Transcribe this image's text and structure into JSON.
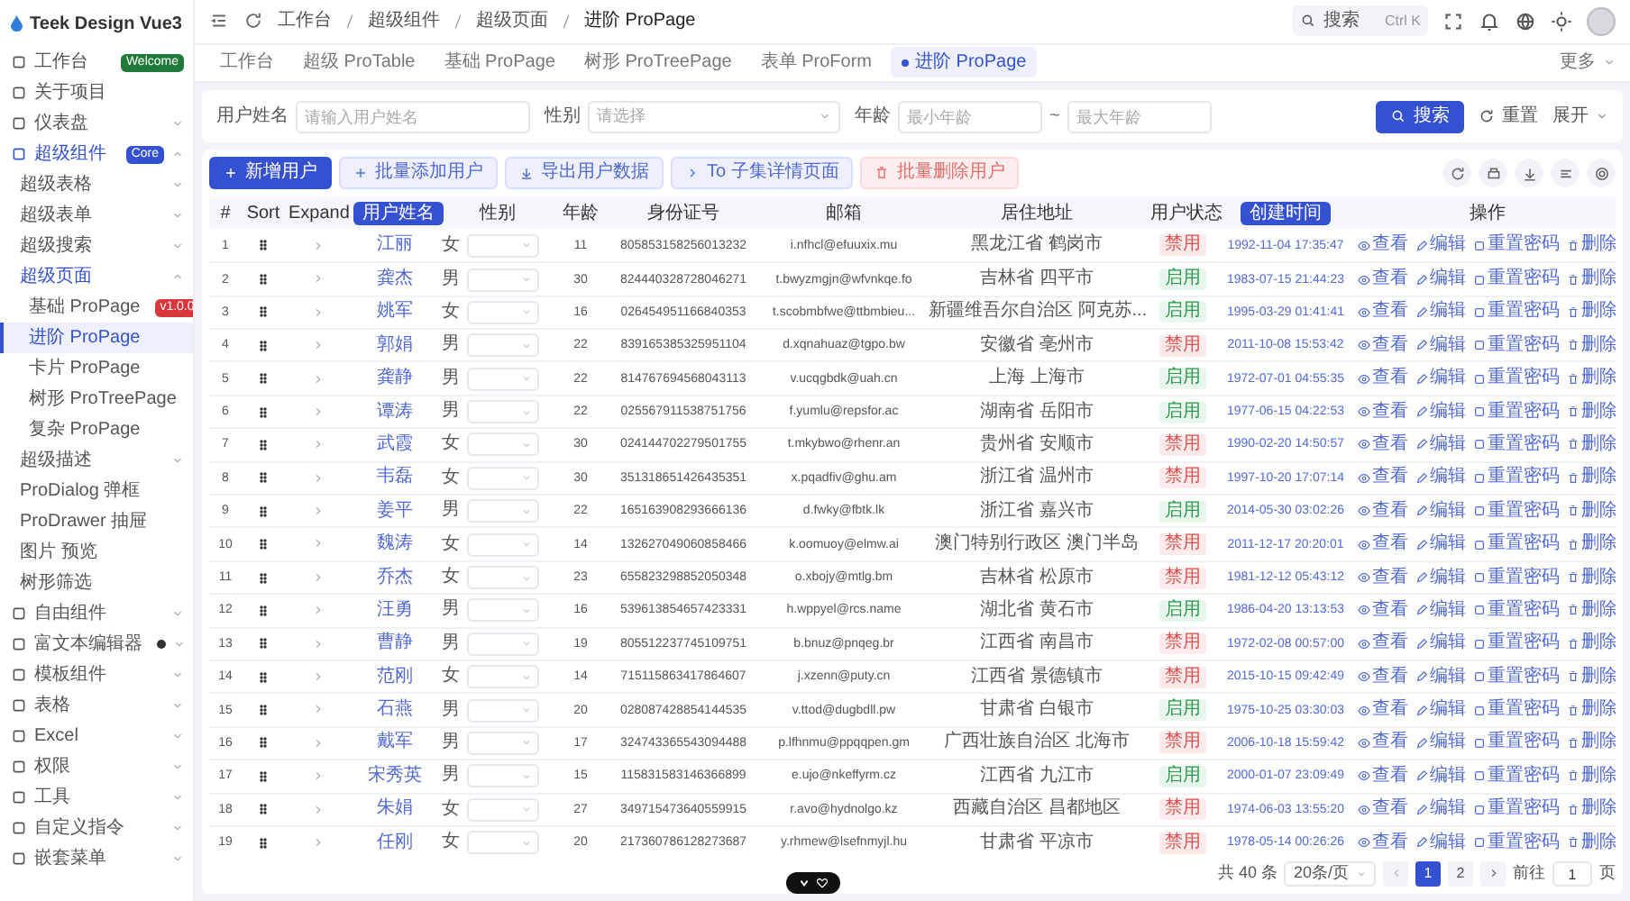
{
  "app": {
    "logo_text": "Teek Design Vue3"
  },
  "sidebar": {
    "items": [
      {
        "label": "工作台",
        "badge": "Welcome",
        "color": "#1f7a3a",
        "selected": false
      },
      {
        "label": "关于项目",
        "selected": false
      },
      {
        "label": "仪表盘",
        "expanded": false,
        "selected": false
      },
      {
        "label": "超级组件",
        "badge": "Core",
        "color": "#3451d1",
        "expanded": true,
        "selected": true,
        "children": [
          {
            "label": "超级表格",
            "expanded": false,
            "selected": false
          },
          {
            "label": "超级表单",
            "expanded": false,
            "selected": false
          },
          {
            "label": "超级搜索",
            "expanded": false,
            "selected": false
          },
          {
            "label": "超级页面",
            "expanded": true,
            "selected": true,
            "children": [
              {
                "label": "基础 ProPage",
                "badge": "v1.0.0",
                "color": "#d9363e",
                "selected": false
              },
              {
                "label": "进阶 ProPage",
                "selected": true
              },
              {
                "label": "卡片 ProPage",
                "selected": false
              },
              {
                "label": "树形 ProTreePage",
                "selected": false
              },
              {
                "label": "复杂 ProPage",
                "selected": false
              }
            ]
          },
          {
            "label": "超级描述",
            "expanded": false,
            "selected": false
          },
          {
            "label": "ProDialog 弹框",
            "selected": false
          },
          {
            "label": "ProDrawer 抽屉",
            "selected": false
          },
          {
            "label": "图片 预览",
            "selected": false
          },
          {
            "label": "树形筛选",
            "selected": false
          }
        ]
      },
      {
        "label": "自由组件",
        "expanded": false,
        "selected": false
      },
      {
        "label": "富文本编辑器",
        "dot": true,
        "expanded": false,
        "selected": false
      },
      {
        "label": "模板组件",
        "expanded": false,
        "selected": false
      },
      {
        "label": "表格",
        "expanded": false,
        "selected": false
      },
      {
        "label": "Excel",
        "expanded": false,
        "selected": false
      },
      {
        "label": "权限",
        "expanded": false,
        "selected": false
      },
      {
        "label": "工具",
        "expanded": false,
        "selected": false
      },
      {
        "label": "自定义指令",
        "expanded": false,
        "selected": false
      },
      {
        "label": "嵌套菜单",
        "expanded": false,
        "selected": false
      }
    ]
  },
  "header": {
    "breadcrumb": [
      "工作台",
      "超级组件",
      "超级页面",
      "进阶 ProPage"
    ],
    "search": {
      "label": "搜索",
      "shortcut": "Ctrl K"
    }
  },
  "tabs": [
    {
      "label": "工作台",
      "selected": false
    },
    {
      "label": "超级 ProTable",
      "selected": false
    },
    {
      "label": "基础 ProPage",
      "selected": false
    },
    {
      "label": "树形 ProTreePage",
      "selected": false
    },
    {
      "label": "表单 ProForm",
      "selected": false
    },
    {
      "label": "进阶 ProPage",
      "selected": true
    }
  ],
  "tabs_more": "更多",
  "search_form": {
    "fields": [
      {
        "kind": "input",
        "label": "用户姓名",
        "placeholder": "请输入用户姓名"
      },
      {
        "kind": "select",
        "label": "性别",
        "placeholder": "请选择"
      },
      {
        "kind": "range",
        "label": "年龄",
        "placeholder": "最小年龄",
        "separator": "~",
        "placeholder_end": "最大年龄"
      }
    ],
    "search_button": "搜索",
    "reset_button": "重置",
    "expand_button": "展开"
  },
  "toolbar": {
    "buttons": [
      {
        "label": "新增用户",
        "kind": "primary",
        "disabled": false
      },
      {
        "label": "批量添加用户",
        "kind": "light",
        "disabled": false
      },
      {
        "label": "导出用户数据",
        "kind": "light",
        "disabled": false
      },
      {
        "label": "To 子集详情页面",
        "kind": "light",
        "disabled": false
      },
      {
        "label": "批量删除用户",
        "kind": "danger",
        "disabled": true
      }
    ]
  },
  "table": {
    "columns": [
      {
        "label": "#",
        "highlighted": false
      },
      {
        "label": "Sort",
        "highlighted": false
      },
      {
        "label": "Expand",
        "highlighted": false
      },
      {
        "label": "用户姓名",
        "highlighted": true
      },
      {
        "label": "性别",
        "highlighted": false
      },
      {
        "label": "年龄",
        "highlighted": false
      },
      {
        "label": "身份证号",
        "highlighted": false
      },
      {
        "label": "邮箱",
        "highlighted": false
      },
      {
        "label": "居住地址",
        "highlighted": false
      },
      {
        "label": "用户状态",
        "highlighted": false
      },
      {
        "label": "创建时间",
        "highlighted": true
      },
      {
        "label": "操作",
        "highlighted": false
      }
    ],
    "rows": [
      {
        "index": "1",
        "name": "江丽",
        "gender": "女",
        "age": "11",
        "id_card": "805853158256013232",
        "email": "i.nfhcl@efuuxix.mu",
        "address": "黑龙江省 鹤岗市",
        "status": "禁用",
        "enabled": false,
        "created": "1992-11-04 17:35:47",
        "actions": [
          "查看",
          "编辑",
          "重置密码",
          "删除"
        ]
      },
      {
        "index": "2",
        "name": "龚杰",
        "gender": "男",
        "age": "30",
        "id_card": "824440328728046271",
        "email": "t.bwyzmgjn@wfvnkqe.fo",
        "address": "吉林省 四平市",
        "status": "启用",
        "enabled": true,
        "created": "1983-07-15 21:44:23",
        "actions": [
          "查看",
          "编辑",
          "重置密码",
          "删除"
        ]
      },
      {
        "index": "3",
        "name": "姚军",
        "gender": "女",
        "age": "16",
        "id_card": "026454951166840353",
        "email": "t.scobmbfwe@ttbmbieu...",
        "address": "新疆维吾尔自治区 阿克苏...",
        "status": "启用",
        "enabled": true,
        "created": "1995-03-29 01:41:41",
        "actions": [
          "查看",
          "编辑",
          "重置密码",
          "删除"
        ]
      },
      {
        "index": "4",
        "name": "郭娟",
        "gender": "男",
        "age": "22",
        "id_card": "839165385325951104",
        "email": "d.xqnahuaz@tgpo.bw",
        "address": "安徽省 亳州市",
        "status": "禁用",
        "enabled": false,
        "created": "2011-10-08 15:53:42",
        "actions": [
          "查看",
          "编辑",
          "重置密码",
          "删除"
        ]
      },
      {
        "index": "5",
        "name": "龚静",
        "gender": "男",
        "age": "22",
        "id_card": "814767694568043113",
        "email": "v.ucqgbdk@uah.cn",
        "address": "上海 上海市",
        "status": "启用",
        "enabled": true,
        "created": "1972-07-01 04:55:35",
        "actions": [
          "查看",
          "编辑",
          "重置密码",
          "删除"
        ]
      },
      {
        "index": "6",
        "name": "谭涛",
        "gender": "男",
        "age": "22",
        "id_card": "025567911538751756",
        "email": "f.yumlu@repsfor.ac",
        "address": "湖南省 岳阳市",
        "status": "启用",
        "enabled": true,
        "created": "1977-06-15 04:22:53",
        "actions": [
          "查看",
          "编辑",
          "重置密码",
          "删除"
        ]
      },
      {
        "index": "7",
        "name": "武霞",
        "gender": "女",
        "age": "30",
        "id_card": "024144702279501755",
        "email": "t.mkybwo@rhenr.an",
        "address": "贵州省 安顺市",
        "status": "禁用",
        "enabled": false,
        "created": "1990-02-20 14:50:57",
        "actions": [
          "查看",
          "编辑",
          "重置密码",
          "删除"
        ]
      },
      {
        "index": "8",
        "name": "韦磊",
        "gender": "女",
        "age": "30",
        "id_card": "351318651426435351",
        "email": "x.pqadfiv@ghu.am",
        "address": "浙江省 温州市",
        "status": "禁用",
        "enabled": false,
        "created": "1997-10-20 17:07:14",
        "actions": [
          "查看",
          "编辑",
          "重置密码",
          "删除"
        ]
      },
      {
        "index": "9",
        "name": "姜平",
        "gender": "男",
        "age": "22",
        "id_card": "165163908293666136",
        "email": "d.fwky@fbtk.lk",
        "address": "浙江省 嘉兴市",
        "status": "启用",
        "enabled": true,
        "created": "2014-05-30 03:02:26",
        "actions": [
          "查看",
          "编辑",
          "重置密码",
          "删除"
        ]
      },
      {
        "index": "10",
        "name": "魏涛",
        "gender": "女",
        "age": "14",
        "id_card": "132627049060858466",
        "email": "k.oomuoy@elmw.ai",
        "address": "澳门特别行政区 澳门半岛",
        "status": "禁用",
        "enabled": false,
        "created": "2011-12-17 20:20:01",
        "actions": [
          "查看",
          "编辑",
          "重置密码",
          "删除"
        ]
      },
      {
        "index": "11",
        "name": "乔杰",
        "gender": "女",
        "age": "23",
        "id_card": "655823298852050348",
        "email": "o.xbojy@mtlg.bm",
        "address": "吉林省 松原市",
        "status": "禁用",
        "enabled": false,
        "created": "1981-12-12 05:43:12",
        "actions": [
          "查看",
          "编辑",
          "重置密码",
          "删除"
        ]
      },
      {
        "index": "12",
        "name": "汪勇",
        "gender": "男",
        "age": "16",
        "id_card": "539613854657423331",
        "email": "h.wppyel@rcs.name",
        "address": "湖北省 黄石市",
        "status": "启用",
        "enabled": true,
        "created": "1986-04-20 13:13:53",
        "actions": [
          "查看",
          "编辑",
          "重置密码",
          "删除"
        ]
      },
      {
        "index": "13",
        "name": "曹静",
        "gender": "男",
        "age": "19",
        "id_card": "805512237745109751",
        "email": "b.bnuz@pnqeg.br",
        "address": "江西省 南昌市",
        "status": "禁用",
        "enabled": false,
        "created": "1972-02-08 00:57:00",
        "actions": [
          "查看",
          "编辑",
          "重置密码",
          "删除"
        ]
      },
      {
        "index": "14",
        "name": "范刚",
        "gender": "女",
        "age": "14",
        "id_card": "715115863417864607",
        "email": "j.xzenn@puty.cn",
        "address": "江西省 景德镇市",
        "status": "禁用",
        "enabled": false,
        "created": "2015-10-15 09:42:49",
        "actions": [
          "查看",
          "编辑",
          "重置密码",
          "删除"
        ]
      },
      {
        "index": "15",
        "name": "石燕",
        "gender": "男",
        "age": "20",
        "id_card": "028087428854144535",
        "email": "v.ttod@dugbdll.pw",
        "address": "甘肃省 白银市",
        "status": "启用",
        "enabled": true,
        "created": "1975-10-25 03:30:03",
        "actions": [
          "查看",
          "编辑",
          "重置密码",
          "删除"
        ]
      },
      {
        "index": "16",
        "name": "戴军",
        "gender": "男",
        "age": "17",
        "id_card": "324743365543094488",
        "email": "p.lfhnmu@ppqqpen.gm",
        "address": "广西壮族自治区 北海市",
        "status": "禁用",
        "enabled": false,
        "created": "2006-10-18 15:59:42",
        "actions": [
          "查看",
          "编辑",
          "重置密码",
          "删除"
        ]
      },
      {
        "index": "17",
        "name": "宋秀英",
        "gender": "男",
        "age": "15",
        "id_card": "115831583146366899",
        "email": "e.ujo@nkeffyrm.cz",
        "address": "江西省 九江市",
        "status": "启用",
        "enabled": true,
        "created": "2000-01-07 23:09:49",
        "actions": [
          "查看",
          "编辑",
          "重置密码",
          "删除"
        ]
      },
      {
        "index": "18",
        "name": "朱娟",
        "gender": "女",
        "age": "27",
        "id_card": "349715473640559915",
        "email": "r.avo@hydnolgo.kz",
        "address": "西藏自治区 昌都地区",
        "status": "禁用",
        "enabled": false,
        "created": "1974-06-03 13:55:20",
        "actions": [
          "查看",
          "编辑",
          "重置密码",
          "删除"
        ]
      },
      {
        "index": "19",
        "name": "任刚",
        "gender": "女",
        "age": "20",
        "id_card": "217360786128273687",
        "email": "y.rhmew@lsefnmyjl.hu",
        "address": "甘肃省 平凉市",
        "status": "禁用",
        "enabled": false,
        "created": "1978-05-14 00:26:26",
        "actions": [
          "查看",
          "编辑",
          "重置密码",
          "删除"
        ]
      }
    ]
  },
  "pagination": {
    "total": "共 40 条",
    "page_size": "20条/页",
    "pages": [
      {
        "label": "1",
        "selected": true
      },
      {
        "label": "2",
        "selected": false
      }
    ],
    "goto_label": "前往",
    "goto_value": "1",
    "goto_suffix": "页"
  }
}
